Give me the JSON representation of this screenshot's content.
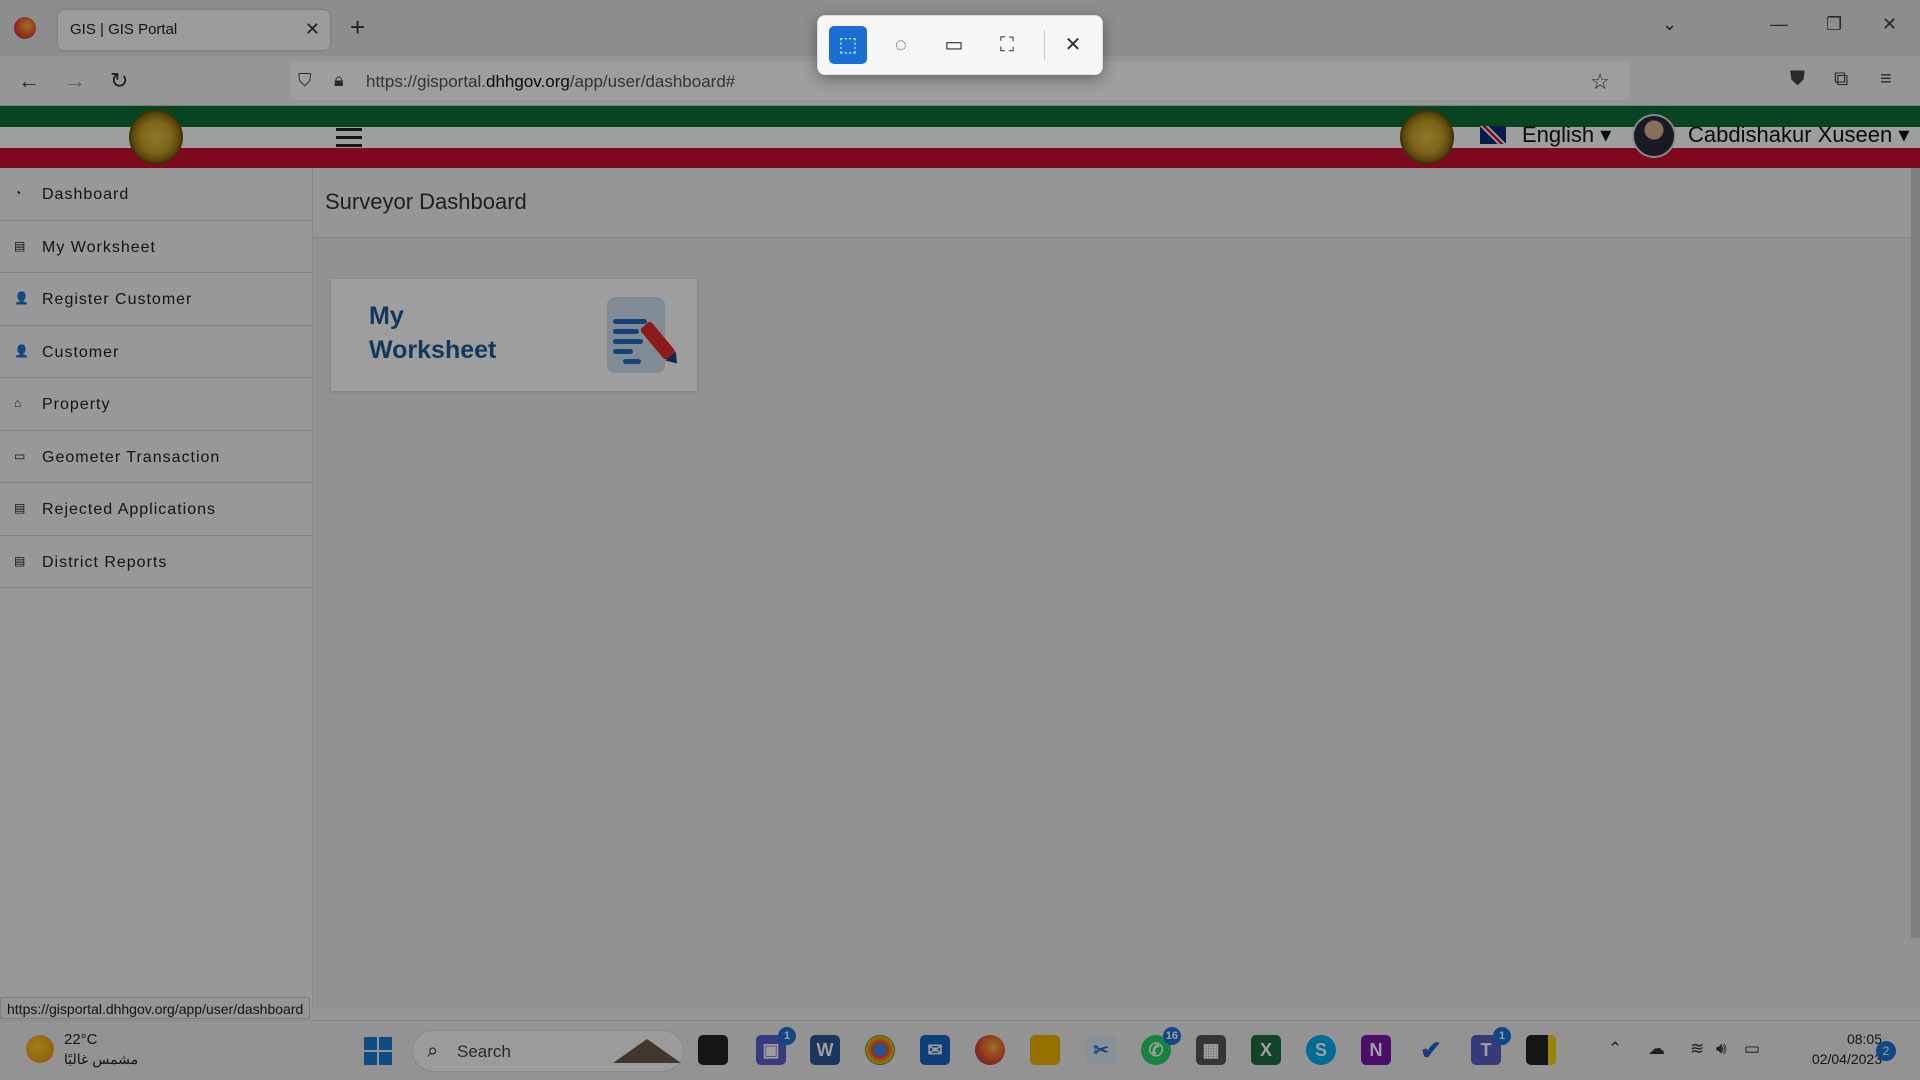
{
  "browser": {
    "tab_title": "GIS | GIS Portal",
    "url_prefix": "https://gisportal.",
    "url_domain": "dhhgov.org",
    "url_suffix": "/app/user/dashboard#",
    "status_url": "https://gisportal.dhhgov.org/app/user/dashboard"
  },
  "header": {
    "language": "English ▾",
    "username": "Cabdishakur Xuseen ▾"
  },
  "sidebar": {
    "items": [
      {
        "label": "Dashboard",
        "icon": "dashboard-icon",
        "glyph": "◔"
      },
      {
        "label": "My Worksheet",
        "icon": "worksheet-icon",
        "glyph": "▤"
      },
      {
        "label": "Register Customer",
        "icon": "user-icon",
        "glyph": "👤"
      },
      {
        "label": "Customer",
        "icon": "user-icon",
        "glyph": "👤"
      },
      {
        "label": "Property",
        "icon": "home-icon",
        "glyph": "⌂"
      },
      {
        "label": "Geometer Transaction",
        "icon": "card-icon",
        "glyph": "▭"
      },
      {
        "label": "Rejected Applications",
        "icon": "document-icon",
        "glyph": "▤"
      },
      {
        "label": "District Reports",
        "icon": "report-icon",
        "glyph": "▤"
      }
    ]
  },
  "main": {
    "page_title": "Surveyor Dashboard",
    "card_title": "My Worksheet"
  },
  "taskbar": {
    "temperature": "22°C",
    "weather_desc": "مشمس غالبًا",
    "search_placeholder": "Search",
    "time": "08:05",
    "date": "02/04/2023",
    "notifications": "2",
    "teams_badge": "1",
    "whatsapp_badge": "16",
    "teams2_badge": "1"
  },
  "colors": {
    "flag_green": "#0d6e35",
    "flag_red": "#c8102e",
    "card_title": "#1f5a96",
    "snip_active": "#1a6fd6"
  }
}
